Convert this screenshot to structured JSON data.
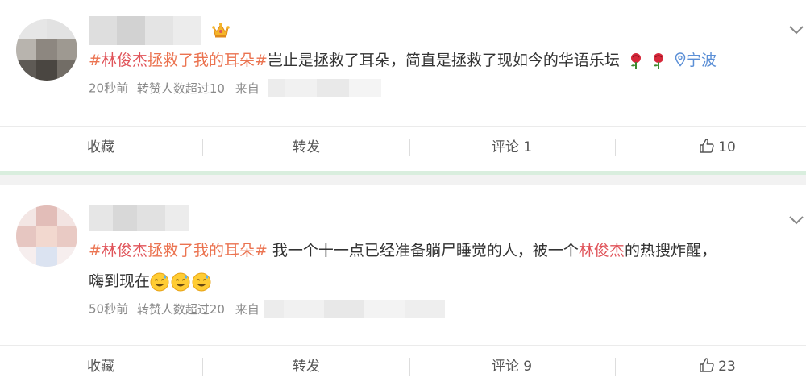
{
  "posts": [
    {
      "text": {
        "tag_open": "#",
        "tag_name": "林俊杰",
        "tag_rest": "拯救了我的耳朵",
        "tag_close": "#",
        "body": "岂止是拯救了耳朵，简直是拯救了现如今的华语乐坛",
        "location": "宁波"
      },
      "meta": {
        "time": "20秒前",
        "repost_info": "转赞人数超过10",
        "from_label": "来自"
      },
      "actions": {
        "favorite": "收藏",
        "repost": "转发",
        "comment": "评论 1",
        "like": "10"
      }
    },
    {
      "text": {
        "tag_open": "#",
        "tag_name": "林俊杰",
        "tag_rest": "拯救了我的耳朵",
        "tag_close": "#",
        "body_before": " 我一个十一点已经准备躺尸睡觉的人，被一个",
        "mention": "林俊杰",
        "body_after": "的热搜炸醒，",
        "line2": "嗨到现在"
      },
      "meta": {
        "time": "50秒前",
        "repost_info": "转赞人数超过20",
        "from_label": "来自"
      },
      "actions": {
        "favorite": "收藏",
        "repost": "转发",
        "comment": "评论 9",
        "like": "23"
      }
    }
  ],
  "icons": {
    "crown": "crown-badge-icon",
    "chevron": "chevron-down-icon",
    "location": "location-pin-icon",
    "rose": "rose-icon",
    "emoji": "sweat-smile-emoji-icon",
    "like": "thumbs-up-icon"
  },
  "colors": {
    "topic": "#eb7350",
    "highlight": "#e0545a",
    "location": "#5b8fd6",
    "meta": "#8a8a8a",
    "separator": "#f2f2f2",
    "separator_accent": "#d9eede"
  }
}
